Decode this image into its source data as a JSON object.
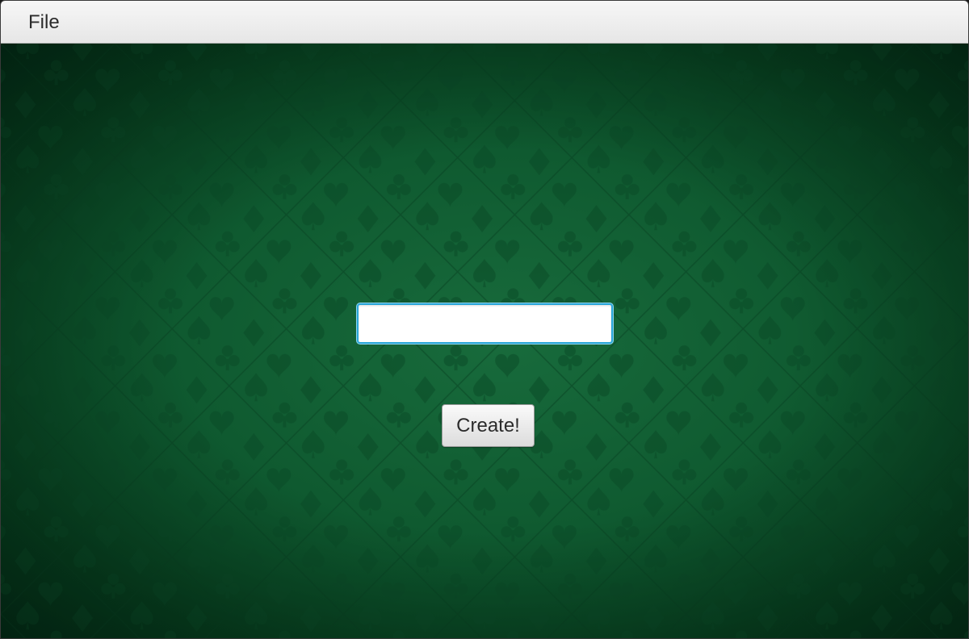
{
  "menubar": {
    "items": [
      {
        "label": "File"
      }
    ]
  },
  "form": {
    "name_input": {
      "value": "",
      "placeholder": ""
    },
    "create_label": "Create!"
  },
  "colors": {
    "felt_green": "#0f5a30",
    "felt_dark": "#03331a",
    "pattern_suit": "#0a4a26",
    "focus_ring": "#2aa6d8"
  }
}
